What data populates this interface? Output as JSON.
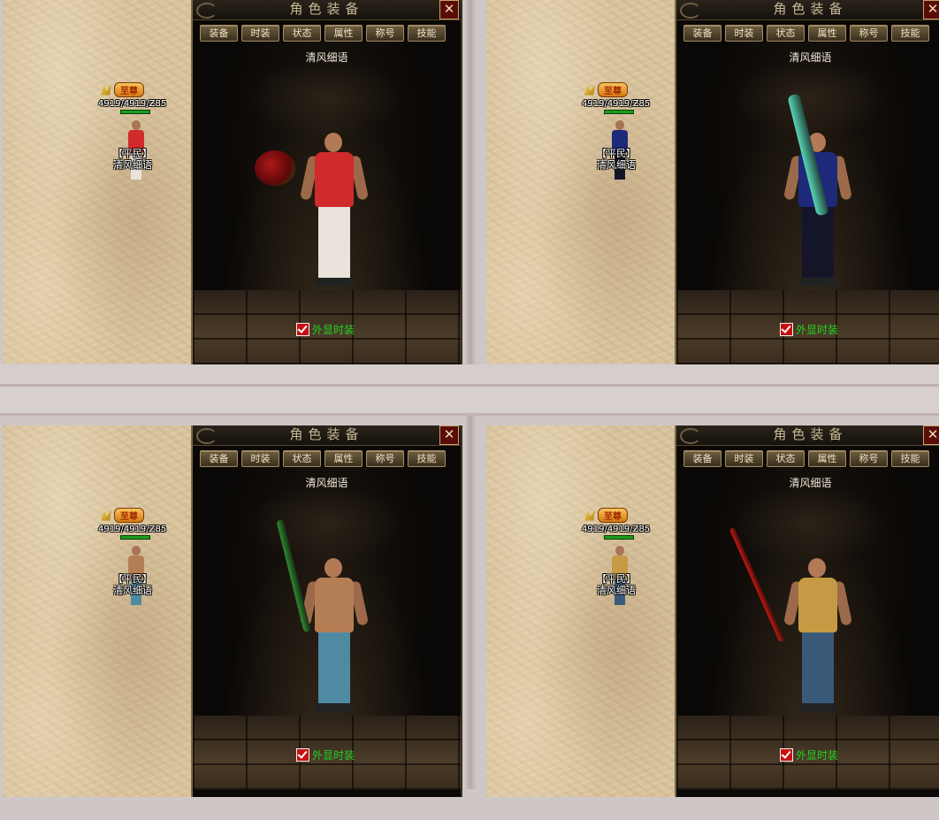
{
  "window": {
    "panel_title": "角色装备",
    "close_label": "✕",
    "tabs": [
      "装备",
      "时装",
      "状态",
      "属性",
      "称号",
      "技能"
    ],
    "fashion_toggle_label": "外显时装",
    "fashion_toggle_checked": true
  },
  "scenes": [
    {
      "rank_badge": "至尊",
      "hp_text": "4919/4919/Z85",
      "guild_tag": "【平民】",
      "player_name": "清风细语",
      "character_name": "清风细语",
      "outfit": "red-jersey-with-roses",
      "colors": {
        "top": "#d02a2c",
        "bottom": "#e9e3dc",
        "accent": "#b01818"
      }
    },
    {
      "rank_badge": "至尊",
      "hp_text": "4919/4919/Z85",
      "guild_tag": "【平民】",
      "player_name": "清风细语",
      "character_name": "清风细语",
      "outfit": "blue-robe-with-jade-bamboo",
      "colors": {
        "top": "#1d2a7a",
        "bottom": "#15152a",
        "accent": "#58d6b6"
      }
    },
    {
      "rank_badge": "至尊",
      "hp_text": "4919/4919/Z85",
      "guild_tag": "【平民】",
      "player_name": "清风细语",
      "character_name": "清风细语",
      "outfit": "hula-skirt-with-green-bamboo",
      "colors": {
        "top": "#b47e55",
        "bottom": "#4f8aa3",
        "accent": "#2e8a2e"
      }
    },
    {
      "rank_badge": "至尊",
      "hp_text": "4919/4919/Z85",
      "guild_tag": "【平民】",
      "player_name": "清风细语",
      "character_name": "清风细语",
      "outfit": "straw-hat-robe-with-red-staff",
      "colors": {
        "top": "#c69a44",
        "bottom": "#3a5a7a",
        "accent": "#c8160f"
      }
    }
  ]
}
